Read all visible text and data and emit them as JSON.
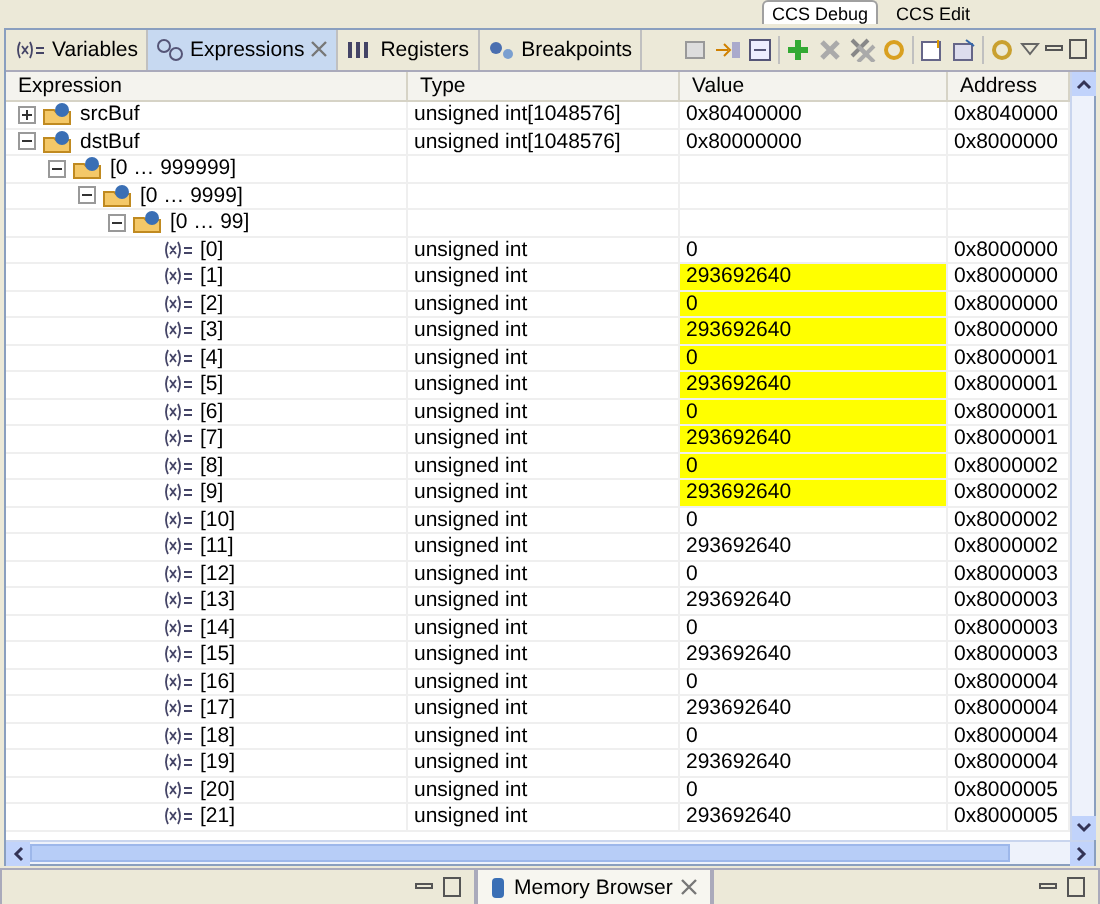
{
  "perspectives": [
    {
      "label": "CCS Debug",
      "selected": true
    },
    {
      "label": "CCS Edit",
      "selected": false
    }
  ],
  "tabs": [
    {
      "label": "Variables",
      "selected": false,
      "kind": "variables"
    },
    {
      "label": "Expressions",
      "selected": true,
      "kind": "expressions"
    },
    {
      "label": "Registers",
      "selected": false,
      "kind": "registers"
    },
    {
      "label": "Breakpoints",
      "selected": false,
      "kind": "breakpoints"
    }
  ],
  "table": {
    "columns": [
      "Expression",
      "Type",
      "Value",
      "Address"
    ],
    "rows": [
      {
        "kind": "array",
        "name": "srcBuf",
        "type": "unsigned int[1048576]",
        "value": "0x80400000",
        "address": "0x8040000",
        "expanded": false
      },
      {
        "kind": "array",
        "name": "dstBuf",
        "type": "unsigned int[1048576]",
        "value": "0x80000000",
        "address": "0x8000000",
        "expanded": true,
        "children": [
          {
            "kind": "array",
            "name": "[0 … 999999]",
            "expanded": true,
            "children": [
              {
                "kind": "array",
                "name": "[0 … 9999]",
                "expanded": true,
                "children": [
                  {
                    "kind": "array",
                    "name": "[0 … 99]",
                    "expanded": true,
                    "children": [
                      {
                        "kind": "element",
                        "name": "[0]",
                        "type": "unsigned int",
                        "value": "0",
                        "address": "0x8000000",
                        "changed": false
                      },
                      {
                        "kind": "element",
                        "name": "[1]",
                        "type": "unsigned int",
                        "value": "293692640",
                        "address": "0x8000000",
                        "changed": true
                      },
                      {
                        "kind": "element",
                        "name": "[2]",
                        "type": "unsigned int",
                        "value": "0",
                        "address": "0x8000000",
                        "changed": true
                      },
                      {
                        "kind": "element",
                        "name": "[3]",
                        "type": "unsigned int",
                        "value": "293692640",
                        "address": "0x8000000",
                        "changed": true
                      },
                      {
                        "kind": "element",
                        "name": "[4]",
                        "type": "unsigned int",
                        "value": "0",
                        "address": "0x8000001",
                        "changed": true
                      },
                      {
                        "kind": "element",
                        "name": "[5]",
                        "type": "unsigned int",
                        "value": "293692640",
                        "address": "0x8000001",
                        "changed": true
                      },
                      {
                        "kind": "element",
                        "name": "[6]",
                        "type": "unsigned int",
                        "value": "0",
                        "address": "0x8000001",
                        "changed": true
                      },
                      {
                        "kind": "element",
                        "name": "[7]",
                        "type": "unsigned int",
                        "value": "293692640",
                        "address": "0x8000001",
                        "changed": true
                      },
                      {
                        "kind": "element",
                        "name": "[8]",
                        "type": "unsigned int",
                        "value": "0",
                        "address": "0x8000002",
                        "changed": true
                      },
                      {
                        "kind": "element",
                        "name": "[9]",
                        "type": "unsigned int",
                        "value": "293692640",
                        "address": "0x8000002",
                        "changed": true
                      },
                      {
                        "kind": "element",
                        "name": "[10]",
                        "type": "unsigned int",
                        "value": "0",
                        "address": "0x8000002",
                        "changed": false
                      },
                      {
                        "kind": "element",
                        "name": "[11]",
                        "type": "unsigned int",
                        "value": "293692640",
                        "address": "0x8000002",
                        "changed": false
                      },
                      {
                        "kind": "element",
                        "name": "[12]",
                        "type": "unsigned int",
                        "value": "0",
                        "address": "0x8000003",
                        "changed": false
                      },
                      {
                        "kind": "element",
                        "name": "[13]",
                        "type": "unsigned int",
                        "value": "293692640",
                        "address": "0x8000003",
                        "changed": false
                      },
                      {
                        "kind": "element",
                        "name": "[14]",
                        "type": "unsigned int",
                        "value": "0",
                        "address": "0x8000003",
                        "changed": false
                      },
                      {
                        "kind": "element",
                        "name": "[15]",
                        "type": "unsigned int",
                        "value": "293692640",
                        "address": "0x8000003",
                        "changed": false
                      },
                      {
                        "kind": "element",
                        "name": "[16]",
                        "type": "unsigned int",
                        "value": "0",
                        "address": "0x8000004",
                        "changed": false
                      },
                      {
                        "kind": "element",
                        "name": "[17]",
                        "type": "unsigned int",
                        "value": "293692640",
                        "address": "0x8000004",
                        "changed": false
                      },
                      {
                        "kind": "element",
                        "name": "[18]",
                        "type": "unsigned int",
                        "value": "0",
                        "address": "0x8000004",
                        "changed": false
                      },
                      {
                        "kind": "element",
                        "name": "[19]",
                        "type": "unsigned int",
                        "value": "293692640",
                        "address": "0x8000004",
                        "changed": false
                      },
                      {
                        "kind": "element",
                        "name": "[20]",
                        "type": "unsigned int",
                        "value": "0",
                        "address": "0x8000005",
                        "changed": false
                      },
                      {
                        "kind": "element",
                        "name": "[21]",
                        "type": "unsigned int",
                        "value": "293692640",
                        "address": "0x8000005",
                        "changed": false
                      }
                    ]
                  }
                ]
              }
            ]
          }
        ]
      }
    ]
  },
  "bottom_tab": {
    "label": "Memory Browser",
    "selected": false
  }
}
